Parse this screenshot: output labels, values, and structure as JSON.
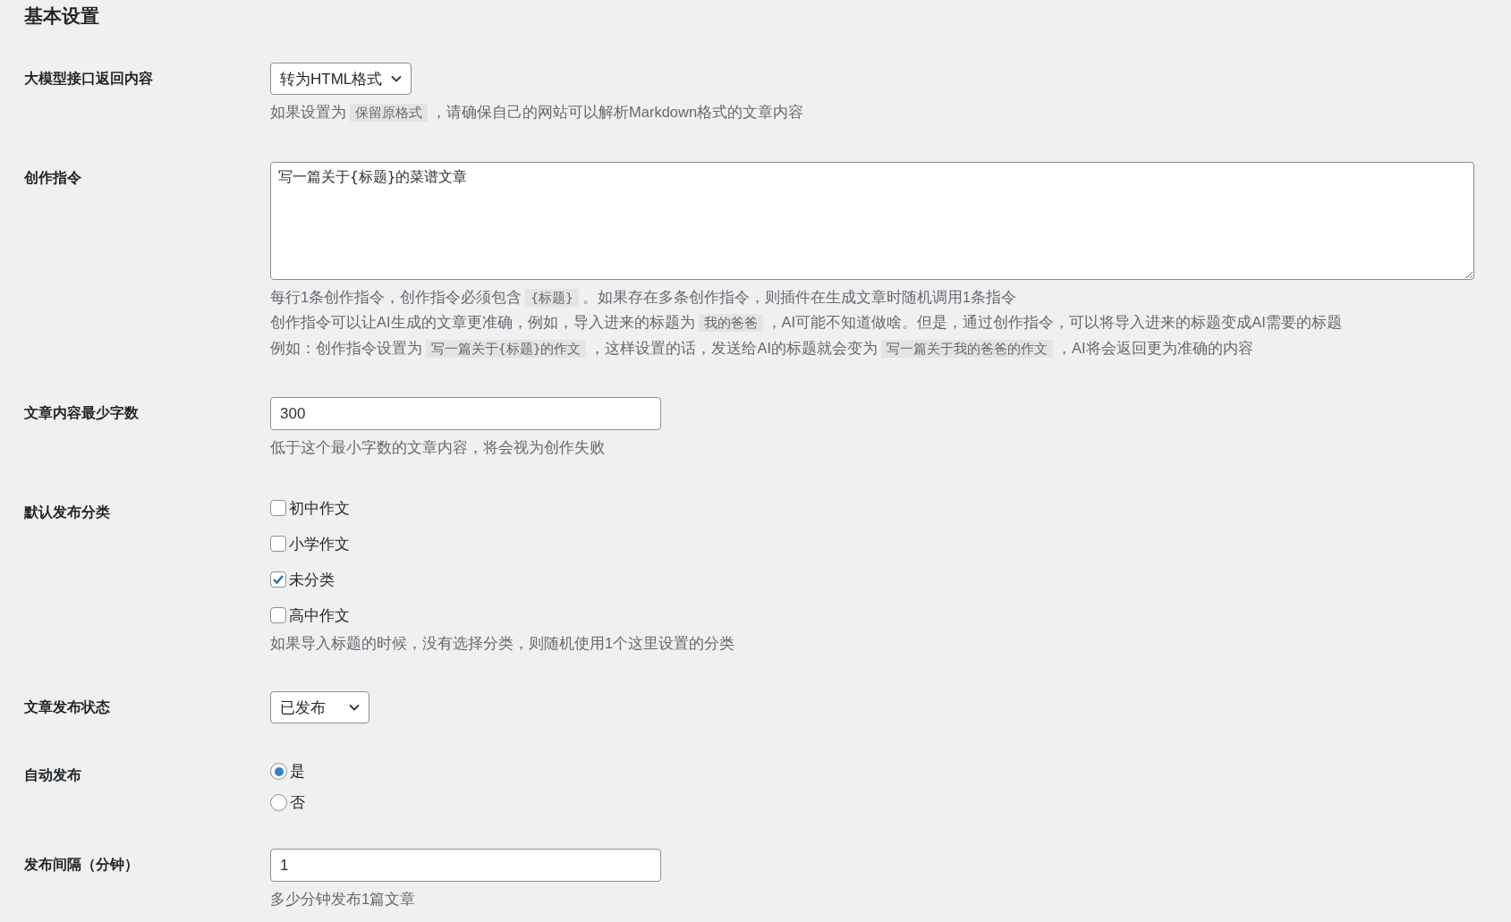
{
  "heading": "基本设置",
  "rows": [
    {
      "kind": "select",
      "label": "大模型接口返回内容",
      "value": "转为HTML格式",
      "description": [
        [
          {
            "text": "如果设置为",
            "code": false
          },
          {
            "text": "保留原格式",
            "code": true
          },
          {
            "text": "，请确保自己的网站可以解析Markdown格式的文章内容",
            "code": false
          }
        ]
      ]
    },
    {
      "kind": "textarea",
      "label": "创作指令",
      "value": "写一篇关于{标题}的菜谱文章",
      "description": [
        [
          {
            "text": "每行1条创作指令，创作指令必须包含",
            "code": false
          },
          {
            "text": "{标题}",
            "code": true
          },
          {
            "text": "。如果存在多条创作指令，则插件在生成文章时随机调用1条指令",
            "code": false
          }
        ],
        [
          {
            "text": "创作指令可以让AI生成的文章更准确，例如，导入进来的标题为",
            "code": false
          },
          {
            "text": "我的爸爸",
            "code": true
          },
          {
            "text": "，AI可能不知道做啥。但是，通过创作指令，可以将导入进来的标题变成AI需要的标题",
            "code": false
          }
        ],
        [
          {
            "text": "例如：创作指令设置为",
            "code": false
          },
          {
            "text": "写一篇关于{标题}的作文",
            "code": true
          },
          {
            "text": "，这样设置的话，发送给AI的标题就会变为",
            "code": false
          },
          {
            "text": "写一篇关于我的爸爸的作文",
            "code": true
          },
          {
            "text": "，AI将会返回更为准确的内容",
            "code": false
          }
        ]
      ]
    },
    {
      "kind": "text",
      "label": "文章内容最少字数",
      "value": "300",
      "description": [
        [
          {
            "text": "低于这个最小字数的文章内容，将会视为创作失败",
            "code": false
          }
        ]
      ]
    },
    {
      "kind": "checkboxes",
      "label": "默认发布分类",
      "options": [
        {
          "label": "初中作文",
          "checked": false
        },
        {
          "label": "小学作文",
          "checked": false
        },
        {
          "label": "未分类",
          "checked": true
        },
        {
          "label": "高中作文",
          "checked": false
        }
      ],
      "description": [
        [
          {
            "text": "如果导入标题的时候，没有选择分类，则随机使用1个这里设置的分类",
            "code": false
          }
        ]
      ]
    },
    {
      "kind": "select",
      "label": "文章发布状态",
      "value": "已发布"
    },
    {
      "kind": "radios",
      "label": "自动发布",
      "options": [
        {
          "label": "是",
          "selected": true
        },
        {
          "label": "否",
          "selected": false
        }
      ]
    },
    {
      "kind": "text",
      "label": "发布间隔（分钟）",
      "value": "1",
      "description": [
        [
          {
            "text": "多少分钟发布1篇文章",
            "code": false
          }
        ]
      ]
    }
  ]
}
